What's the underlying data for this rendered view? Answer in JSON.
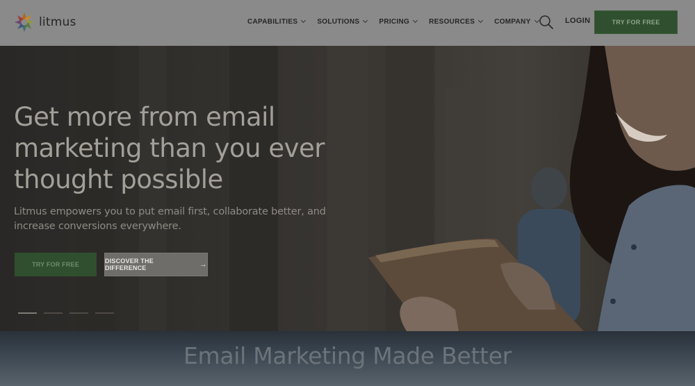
{
  "brand": {
    "name": "litmus"
  },
  "nav": {
    "items": [
      {
        "label": "CAPABILITIES"
      },
      {
        "label": "SOLUTIONS"
      },
      {
        "label": "PRICING"
      },
      {
        "label": "RESOURCES"
      },
      {
        "label": "COMPANY"
      }
    ],
    "login_label": "LOGIN",
    "try_label": "TRY FOR FREE"
  },
  "hero": {
    "title": "Get more from email marketing than you ever thought possible",
    "subtitle": "Litmus empowers you to put email first, collaborate better, and increase conversions everywhere.",
    "try_label": "TRY FOR FREE",
    "discover_label": "DISCOVER THE DIFFERENCE",
    "carousel": {
      "slides": 4,
      "active": 1
    }
  },
  "section2": {
    "title": "Email Marketing Made Better"
  },
  "colors": {
    "accent_green": "#2f4f2f",
    "header_bg": "#8a8a8a",
    "overlay_blue": "#3a4550"
  }
}
